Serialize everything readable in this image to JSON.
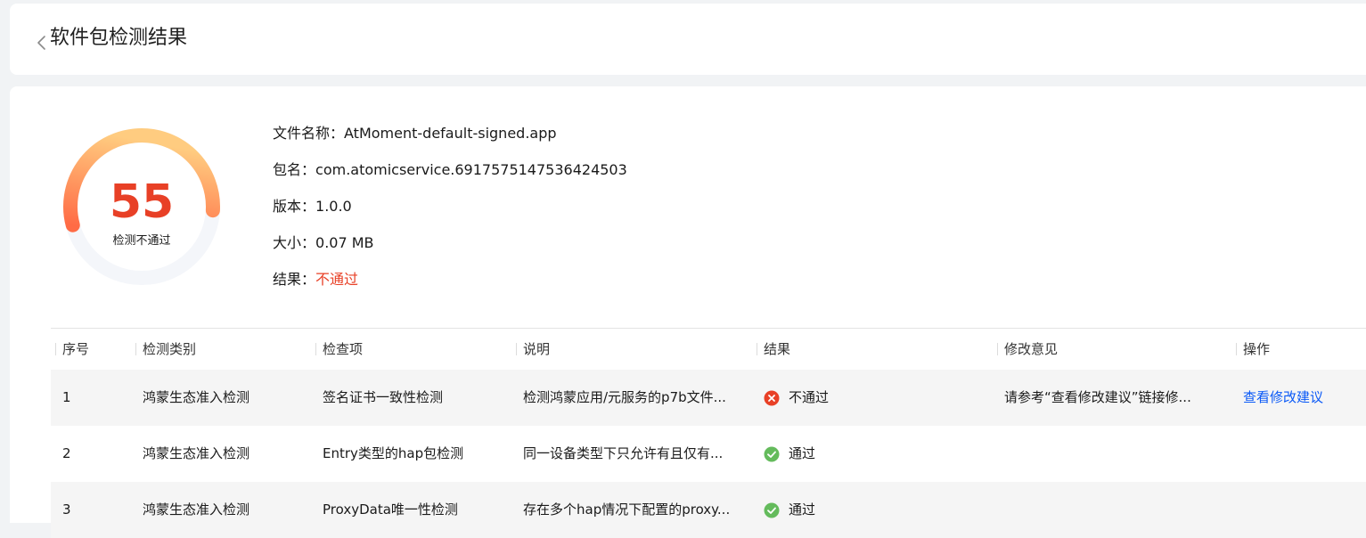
{
  "header": {
    "title": "软件包检测结果",
    "back_icon": "chevron-left-icon"
  },
  "summary": {
    "score": "55",
    "score_label": "检测不通过",
    "score_fraction": 0.55,
    "ring_colors": {
      "start": "#ff6b45",
      "end": "#ffcc80",
      "track": "#f4f6fa"
    }
  },
  "info": {
    "filename_label": "文件名称：",
    "filename": "AtMoment-default-signed.app",
    "package_label": "包名：",
    "package": "com.atomicservice.6917575147536424503",
    "version_label": "版本：",
    "version": "1.0.0",
    "size_label": "大小：",
    "size": "0.07 MB",
    "result_label": "结果：",
    "result": "不通过"
  },
  "table": {
    "headers": [
      "序号",
      "检测类别",
      "检查项",
      "说明",
      "结果",
      "修改意见",
      "操作"
    ],
    "rows": [
      {
        "index": "1",
        "category": "鸿蒙生态准入检测",
        "item": "签名证书一致性检测",
        "desc": "检测鸿蒙应用/元服务的p7b文件...",
        "result": "不通过",
        "status": "fail",
        "advice": "请参考“查看修改建议”链接修...",
        "action": "查看修改建议"
      },
      {
        "index": "2",
        "category": "鸿蒙生态准入检测",
        "item": "Entry类型的hap包检测",
        "desc": "同一设备类型下只允许有且仅有...",
        "result": "通过",
        "status": "pass",
        "advice": "",
        "action": ""
      },
      {
        "index": "3",
        "category": "鸿蒙生态准入检测",
        "item": "ProxyData唯一性检测",
        "desc": "存在多个hap情况下配置的proxy...",
        "result": "通过",
        "status": "pass",
        "advice": "",
        "action": ""
      }
    ]
  },
  "colors": {
    "fail": "#e84026",
    "pass": "#64bb5c",
    "link": "#0a59f7"
  }
}
